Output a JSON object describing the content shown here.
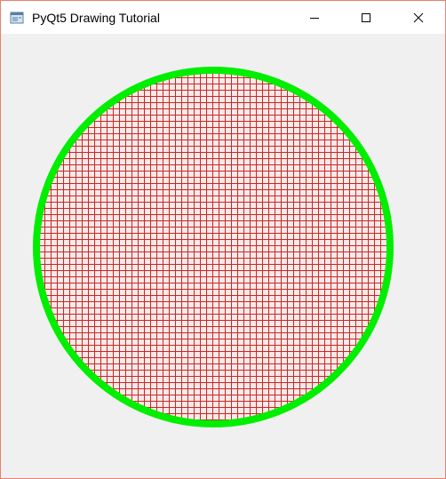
{
  "window": {
    "title": "PyQt5 Drawing Tutorial"
  },
  "titlebar": {
    "icon": "pyqt-window-icon",
    "controls": [
      "minimize-icon",
      "maximize-icon",
      "close-icon"
    ]
  },
  "drawing": {
    "shape": "circle",
    "fill_pattern": "cross-hatch grid",
    "fill_color": "#c62828",
    "fill_background": "#fbe9e7",
    "outline_color": "#00ee00",
    "border_accent": "#e8806a"
  }
}
